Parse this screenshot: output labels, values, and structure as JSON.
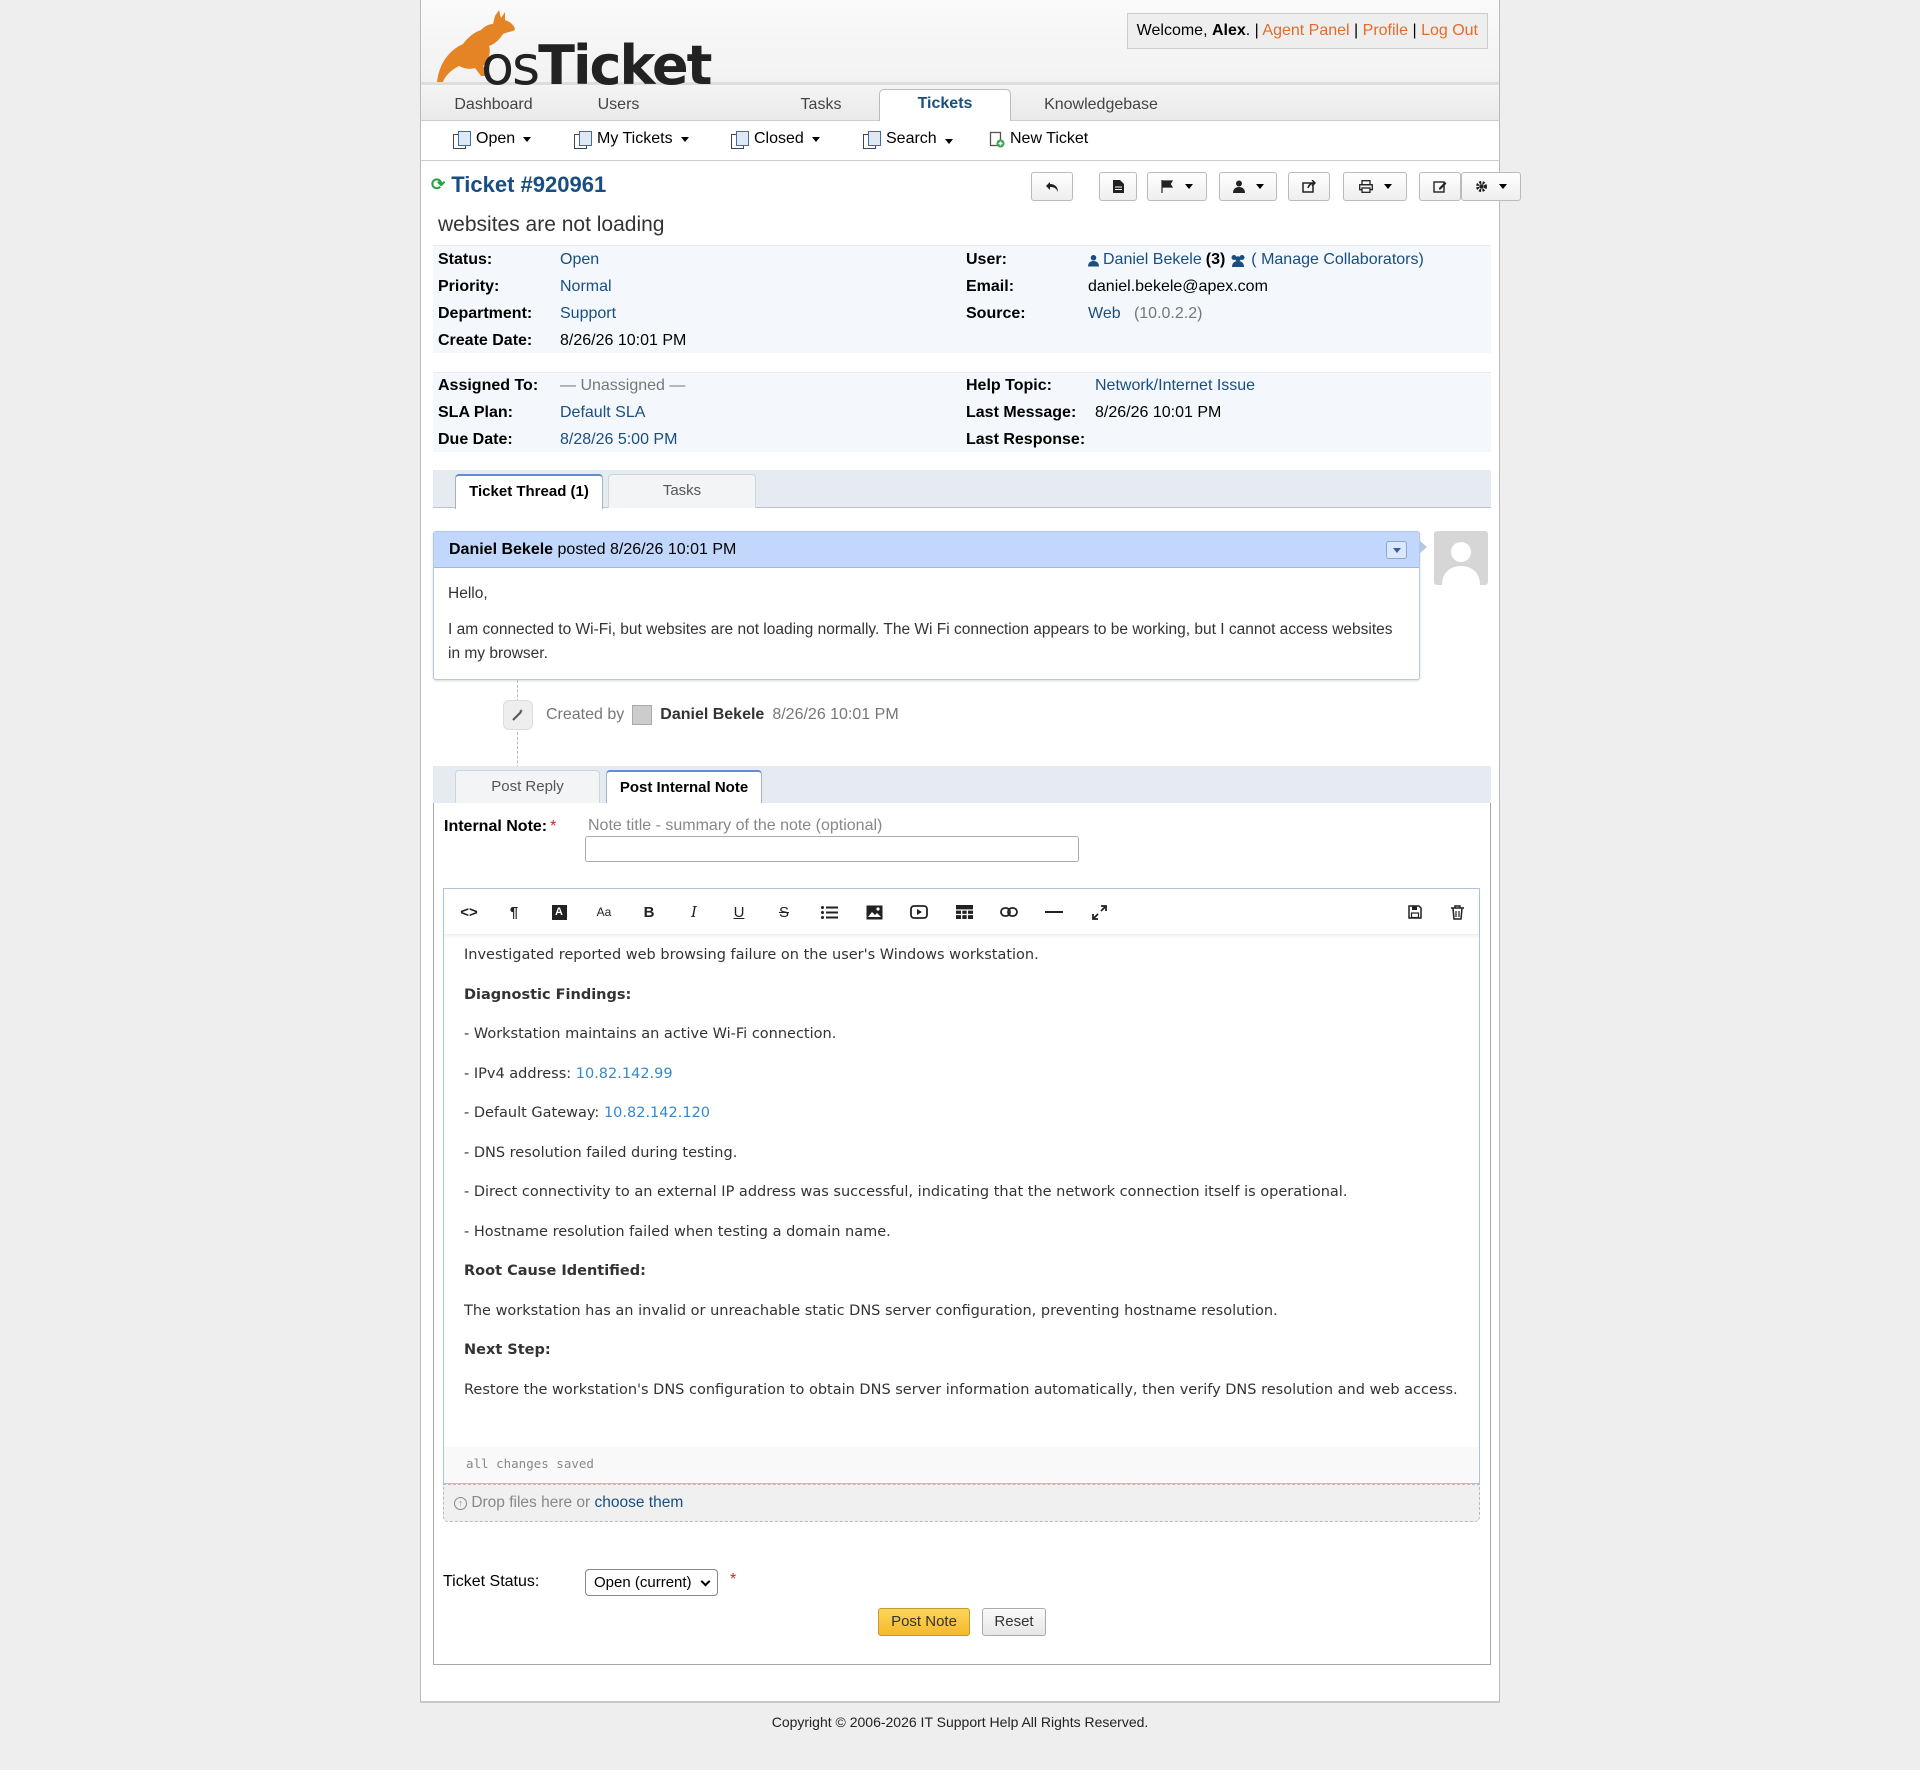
{
  "header": {
    "logo_text_os": "os",
    "logo_text_ticket": "Ticket",
    "welcome_prefix": "Welcome,",
    "user_name": "Alex",
    "welcome_suffix": ".",
    "agent_panel": "Agent Panel",
    "profile": "Profile",
    "logout": "Log Out",
    "sep": "|"
  },
  "nav": {
    "tabs": [
      {
        "label": "Dashboard"
      },
      {
        "label": "Users"
      },
      {
        "label": "Tasks"
      },
      {
        "label": "Tickets"
      },
      {
        "label": "Knowledgebase"
      }
    ],
    "active": "Tickets"
  },
  "subnav": {
    "items": [
      {
        "label": "Open"
      },
      {
        "label": "My Tickets"
      },
      {
        "label": "Closed"
      },
      {
        "label": "Search"
      },
      {
        "label": "New Ticket"
      }
    ]
  },
  "ticket": {
    "number": "Ticket #920961",
    "subject": "websites are not loading",
    "status_label": "Status:",
    "status": "Open",
    "priority_label": "Priority:",
    "priority": "Normal",
    "department_label": "Department:",
    "department": "Support",
    "create_date_label": "Create Date:",
    "create_date": "8/26/26 10:01 PM",
    "user_label": "User:",
    "user": "Daniel Bekele",
    "user_count": "(3)",
    "manage_collab": "( Manage Collaborators)",
    "email_label": "Email:",
    "email": "daniel.bekele@apex.com",
    "source_label": "Source:",
    "source": "Web",
    "source_ip": "(10.0.2.2)",
    "assigned_label": "Assigned To:",
    "assigned": "— Unassigned —",
    "sla_label": "SLA Plan:",
    "sla": "Default SLA",
    "due_label": "Due Date:",
    "due": "8/28/26 5:00 PM",
    "topic_label": "Help Topic:",
    "topic": "Network/Internet Issue",
    "last_msg_label": "Last Message:",
    "last_msg": "8/26/26 10:01 PM",
    "last_resp_label": "Last Response:",
    "last_resp": ""
  },
  "thread_tabs": [
    {
      "label": "Ticket Thread (1)"
    },
    {
      "label": "Tasks"
    }
  ],
  "thread": {
    "author": "Daniel Bekele",
    "posted": "posted 8/26/26 10:01 PM",
    "body_1": "Hello,",
    "body_2": "I am connected to Wi-Fi, but websites are not loading normally. The Wi Fi connection appears to be working, but I cannot access websites in my browser."
  },
  "event": {
    "created_by": "Created by",
    "author": "Daniel Bekele",
    "time": "8/26/26 10:01 PM"
  },
  "response_tabs": [
    {
      "label": "Post Reply"
    },
    {
      "label": "Post Internal Note"
    }
  ],
  "note": {
    "label": "Internal Note:",
    "required": "*",
    "title_placeholder": "Note title - summary of the note (optional)",
    "title_value": "",
    "body": {
      "p1": "Investigated reported web browsing failure on the user's Windows workstation.",
      "h1": "Diagnostic Findings:",
      "l1": "- Workstation maintains an active Wi-Fi connection.",
      "l2_prefix": "- IPv4 address: ",
      "l2_ip": "10.82.142.99",
      "l3_prefix": "- Default Gateway: ",
      "l3_ip": "10.82.142.120",
      "l4": "- DNS resolution failed during testing.",
      "l5": "- Direct connectivity to an external IP address was successful, indicating that the network connection itself is operational.",
      "l6": "- Hostname resolution failed when testing a domain name.",
      "h2": "Root Cause Identified:",
      "p2": "The workstation has an invalid or unreachable static DNS server configuration, preventing hostname resolution.",
      "h3": "Next Step:",
      "p3": "Restore the workstation's DNS configuration to obtain DNS server information automatically, then verify DNS resolution and web access."
    },
    "save_status": "all changes saved",
    "drop_text": "Drop files here or",
    "drop_link": "choose them"
  },
  "status": {
    "label": "Ticket Status:",
    "value": "Open (current)",
    "required": "*"
  },
  "buttons": {
    "post": "Post Note",
    "reset": "Reset"
  },
  "footer": "Copyright © 2006-2026 IT Support Help All Rights Reserved.",
  "colors": {
    "link": "#184e81",
    "orange": "#e66b2b",
    "thread_header": "#c1d7fb",
    "post_button": "#f5b92a"
  }
}
